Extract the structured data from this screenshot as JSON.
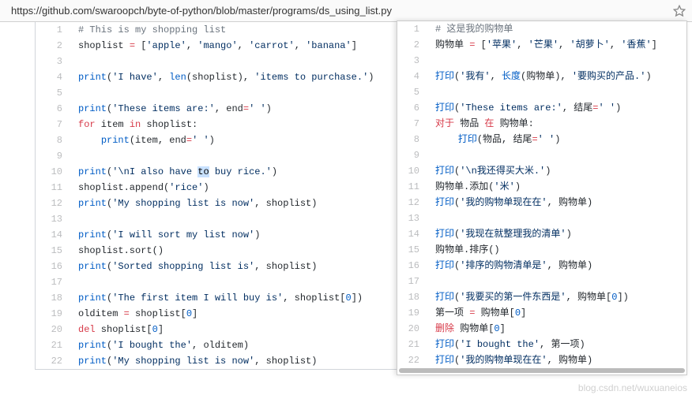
{
  "url": "https://github.com/swaroopch/byte-of-python/blob/master/programs/ds_using_list.py",
  "watermark": "blog.csdn.net/wuxuaneios",
  "left_code": [
    {
      "n": 1,
      "tokens": [
        [
          "c",
          "# This is my shopping list"
        ]
      ]
    },
    {
      "n": 2,
      "tokens": [
        [
          "n",
          "shoplist "
        ],
        [
          "k",
          "="
        ],
        [
          "n",
          " ["
        ],
        [
          "s",
          "'apple'"
        ],
        [
          "n",
          ", "
        ],
        [
          "s",
          "'mango'"
        ],
        [
          "n",
          ", "
        ],
        [
          "s",
          "'carrot'"
        ],
        [
          "n",
          ", "
        ],
        [
          "s",
          "'banana'"
        ],
        [
          "n",
          "]"
        ]
      ]
    },
    {
      "n": 3,
      "tokens": []
    },
    {
      "n": 4,
      "tokens": [
        [
          "f",
          "print"
        ],
        [
          "n",
          "("
        ],
        [
          "s",
          "'I have'"
        ],
        [
          "n",
          ", "
        ],
        [
          "f",
          "len"
        ],
        [
          "n",
          "(shoplist), "
        ],
        [
          "s",
          "'items to purchase.'"
        ],
        [
          "n",
          ")"
        ]
      ]
    },
    {
      "n": 5,
      "tokens": []
    },
    {
      "n": 6,
      "tokens": [
        [
          "f",
          "print"
        ],
        [
          "n",
          "("
        ],
        [
          "s",
          "'These items are:'"
        ],
        [
          "n",
          ", "
        ],
        [
          "nm",
          "end"
        ],
        [
          "k",
          "="
        ],
        [
          "s",
          "' '"
        ],
        [
          "n",
          ")"
        ]
      ]
    },
    {
      "n": 7,
      "tokens": [
        [
          "k",
          "for"
        ],
        [
          "n",
          " item "
        ],
        [
          "k",
          "in"
        ],
        [
          "n",
          " shoplist:"
        ]
      ]
    },
    {
      "n": 8,
      "tokens": [
        [
          "n",
          "    "
        ],
        [
          "f",
          "print"
        ],
        [
          "n",
          "(item, "
        ],
        [
          "nm",
          "end"
        ],
        [
          "k",
          "="
        ],
        [
          "s",
          "' '"
        ],
        [
          "n",
          ")"
        ]
      ]
    },
    {
      "n": 9,
      "tokens": []
    },
    {
      "n": 10,
      "tokens": [
        [
          "f",
          "print"
        ],
        [
          "n",
          "("
        ],
        [
          "s",
          "'"
        ],
        [
          "s",
          "\\n"
        ],
        [
          "s",
          "I also have "
        ],
        [
          "sel",
          "to"
        ],
        [
          "s",
          " buy rice.'"
        ],
        [
          "n",
          ")"
        ]
      ]
    },
    {
      "n": 11,
      "tokens": [
        [
          "n",
          "shoplist.append("
        ],
        [
          "s",
          "'rice'"
        ],
        [
          "n",
          ")"
        ]
      ]
    },
    {
      "n": 12,
      "tokens": [
        [
          "f",
          "print"
        ],
        [
          "n",
          "("
        ],
        [
          "s",
          "'My shopping list is now'"
        ],
        [
          "n",
          ", shoplist)"
        ]
      ]
    },
    {
      "n": 13,
      "tokens": []
    },
    {
      "n": 14,
      "tokens": [
        [
          "f",
          "print"
        ],
        [
          "n",
          "("
        ],
        [
          "s",
          "'I will sort my list now'"
        ],
        [
          "n",
          ")"
        ]
      ]
    },
    {
      "n": 15,
      "tokens": [
        [
          "n",
          "shoplist.sort()"
        ]
      ]
    },
    {
      "n": 16,
      "tokens": [
        [
          "f",
          "print"
        ],
        [
          "n",
          "("
        ],
        [
          "s",
          "'Sorted shopping list is'"
        ],
        [
          "n",
          ", shoplist)"
        ]
      ]
    },
    {
      "n": 17,
      "tokens": []
    },
    {
      "n": 18,
      "tokens": [
        [
          "f",
          "print"
        ],
        [
          "n",
          "("
        ],
        [
          "s",
          "'The first item I will buy is'"
        ],
        [
          "n",
          ", shoplist["
        ],
        [
          "f",
          "0"
        ],
        [
          "n",
          "])"
        ]
      ]
    },
    {
      "n": 19,
      "tokens": [
        [
          "n",
          "olditem "
        ],
        [
          "k",
          "="
        ],
        [
          "n",
          " shoplist["
        ],
        [
          "f",
          "0"
        ],
        [
          "n",
          "]"
        ]
      ]
    },
    {
      "n": 20,
      "tokens": [
        [
          "k",
          "del"
        ],
        [
          "n",
          " shoplist["
        ],
        [
          "f",
          "0"
        ],
        [
          "n",
          "]"
        ]
      ]
    },
    {
      "n": 21,
      "tokens": [
        [
          "f",
          "print"
        ],
        [
          "n",
          "("
        ],
        [
          "s",
          "'I bought the'"
        ],
        [
          "n",
          ", olditem)"
        ]
      ]
    },
    {
      "n": 22,
      "tokens": [
        [
          "f",
          "print"
        ],
        [
          "n",
          "("
        ],
        [
          "s",
          "'My shopping list is now'"
        ],
        [
          "n",
          ", shoplist)"
        ]
      ]
    }
  ],
  "right_code": [
    {
      "n": 1,
      "tokens": [
        [
          "c",
          "# 这是我的购物单"
        ]
      ]
    },
    {
      "n": 2,
      "tokens": [
        [
          "n",
          "购物单 "
        ],
        [
          "k",
          "="
        ],
        [
          "n",
          " ["
        ],
        [
          "s",
          "'苹果'"
        ],
        [
          "n",
          ", "
        ],
        [
          "s",
          "'芒果'"
        ],
        [
          "n",
          ", "
        ],
        [
          "s",
          "'胡萝卜'"
        ],
        [
          "n",
          ", "
        ],
        [
          "s",
          "'香蕉'"
        ],
        [
          "n",
          "]"
        ]
      ]
    },
    {
      "n": 3,
      "tokens": []
    },
    {
      "n": 4,
      "tokens": [
        [
          "f",
          "打印"
        ],
        [
          "n",
          "("
        ],
        [
          "s",
          "'我有'"
        ],
        [
          "n",
          ", "
        ],
        [
          "f",
          "长度"
        ],
        [
          "n",
          "(购物单), "
        ],
        [
          "s",
          "'要购买的产品.'"
        ],
        [
          "n",
          ")"
        ]
      ]
    },
    {
      "n": 5,
      "tokens": []
    },
    {
      "n": 6,
      "tokens": [
        [
          "f",
          "打印"
        ],
        [
          "n",
          "("
        ],
        [
          "s",
          "'These items are:'"
        ],
        [
          "n",
          ", "
        ],
        [
          "nm",
          "结尾"
        ],
        [
          "k",
          "="
        ],
        [
          "s",
          "' '"
        ],
        [
          "n",
          ")"
        ]
      ]
    },
    {
      "n": 7,
      "tokens": [
        [
          "k",
          "对于"
        ],
        [
          "n",
          " 物品 "
        ],
        [
          "k",
          "在"
        ],
        [
          "n",
          " 购物单:"
        ]
      ]
    },
    {
      "n": 8,
      "tokens": [
        [
          "n",
          "    "
        ],
        [
          "f",
          "打印"
        ],
        [
          "n",
          "(物品, "
        ],
        [
          "nm",
          "结尾"
        ],
        [
          "k",
          "="
        ],
        [
          "s",
          "' '"
        ],
        [
          "n",
          ")"
        ]
      ]
    },
    {
      "n": 9,
      "tokens": []
    },
    {
      "n": 10,
      "tokens": [
        [
          "f",
          "打印"
        ],
        [
          "n",
          "("
        ],
        [
          "s",
          "'"
        ],
        [
          "s",
          "\\n"
        ],
        [
          "s",
          "我还得买大米.'"
        ],
        [
          "n",
          ")"
        ]
      ]
    },
    {
      "n": 11,
      "tokens": [
        [
          "n",
          "购物单.添加("
        ],
        [
          "s",
          "'米'"
        ],
        [
          "n",
          ")"
        ]
      ]
    },
    {
      "n": 12,
      "tokens": [
        [
          "f",
          "打印"
        ],
        [
          "n",
          "("
        ],
        [
          "s",
          "'我的购物单现在在'"
        ],
        [
          "n",
          ", 购物单)"
        ]
      ]
    },
    {
      "n": 13,
      "tokens": []
    },
    {
      "n": 14,
      "tokens": [
        [
          "f",
          "打印"
        ],
        [
          "n",
          "("
        ],
        [
          "s",
          "'我现在就整理我的清单'"
        ],
        [
          "n",
          ")"
        ]
      ]
    },
    {
      "n": 15,
      "tokens": [
        [
          "n",
          "购物单.排序()"
        ]
      ]
    },
    {
      "n": 16,
      "tokens": [
        [
          "f",
          "打印"
        ],
        [
          "n",
          "("
        ],
        [
          "s",
          "'排序的购物清单是'"
        ],
        [
          "n",
          ", 购物单)"
        ]
      ]
    },
    {
      "n": 17,
      "tokens": []
    },
    {
      "n": 18,
      "tokens": [
        [
          "f",
          "打印"
        ],
        [
          "n",
          "("
        ],
        [
          "s",
          "'我要买的第一件东西是'"
        ],
        [
          "n",
          ", 购物单["
        ],
        [
          "f",
          "0"
        ],
        [
          "n",
          "])"
        ]
      ]
    },
    {
      "n": 19,
      "tokens": [
        [
          "n",
          "第一项 "
        ],
        [
          "k",
          "="
        ],
        [
          "n",
          " 购物单["
        ],
        [
          "f",
          "0"
        ],
        [
          "n",
          "]"
        ]
      ]
    },
    {
      "n": 20,
      "tokens": [
        [
          "k",
          "删除"
        ],
        [
          "n",
          " 购物单["
        ],
        [
          "f",
          "0"
        ],
        [
          "n",
          "]"
        ]
      ]
    },
    {
      "n": 21,
      "tokens": [
        [
          "f",
          "打印"
        ],
        [
          "n",
          "("
        ],
        [
          "s",
          "'I bought the'"
        ],
        [
          "n",
          ", 第一项)"
        ]
      ]
    },
    {
      "n": 22,
      "tokens": [
        [
          "f",
          "打印"
        ],
        [
          "n",
          "("
        ],
        [
          "s",
          "'我的购物单现在在'"
        ],
        [
          "n",
          ", 购物单)"
        ]
      ]
    }
  ]
}
